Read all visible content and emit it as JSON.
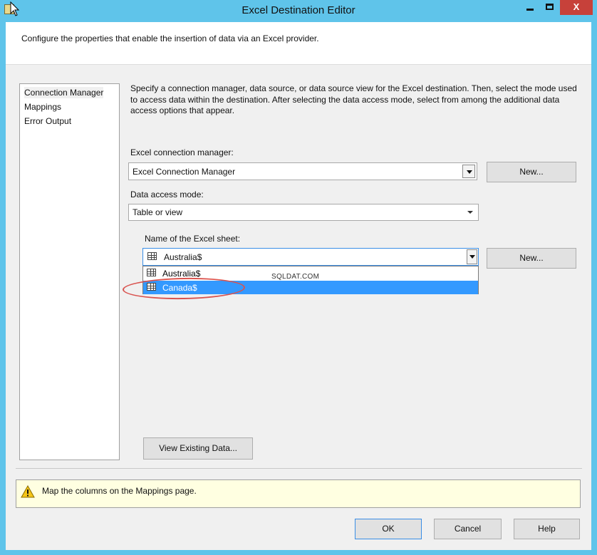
{
  "window": {
    "title": "Excel Destination Editor",
    "min_label": "",
    "max_label": "",
    "close_label": "X"
  },
  "header": {
    "text": "Configure the properties that enable the insertion of data via an Excel provider."
  },
  "nav": {
    "items": [
      {
        "label": "Connection Manager",
        "selected": true
      },
      {
        "label": "Mappings",
        "selected": false
      },
      {
        "label": "Error Output",
        "selected": false
      }
    ]
  },
  "main": {
    "description": "Specify a connection manager, data source, or data source view for the Excel destination. Then, select the mode used to access data within the destination. After selecting the data access mode, select from among the additional data access options that appear.",
    "connection_manager": {
      "label": "Excel connection manager:",
      "value": "Excel Connection Manager",
      "new_button": "New..."
    },
    "access_mode": {
      "label": "Data access mode:",
      "value": "Table or view"
    },
    "sheet": {
      "label": "Name of the Excel sheet:",
      "value": "Australia$",
      "new_button": "New...",
      "options": [
        "Australia$",
        "Canada$"
      ],
      "highlighted": "Canada$"
    },
    "view_data_button": "View Existing Data...",
    "watermark": "SQLDAT.COM"
  },
  "message": {
    "icon": "warning-icon",
    "text": "Map the columns on the Mappings page."
  },
  "footer": {
    "ok": "OK",
    "cancel": "Cancel",
    "help": "Help"
  },
  "colors": {
    "titlebar": "#5fc4ea",
    "close_button": "#c7413a",
    "highlight": "#3399ff",
    "annotation_ellipse": "#d9534f",
    "message_bg": "#ffffe1"
  }
}
